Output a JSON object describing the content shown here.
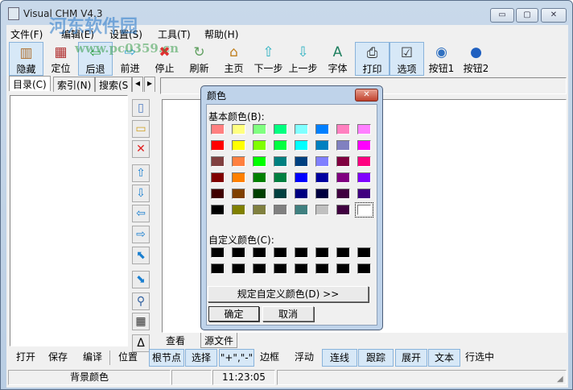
{
  "window": {
    "title": "Visual CHM V4.3",
    "minimize": "▭",
    "maximize": "▢",
    "close": "✕"
  },
  "watermark": {
    "name": "河东软件园",
    "url": "www.pc0359.cn"
  },
  "menu": [
    "文件(F)",
    "编辑(E)",
    "设置(S)",
    "工具(T)",
    "帮助(H)"
  ],
  "toolbar": [
    {
      "label": "隐藏",
      "icon": "hide-icon",
      "glyph": "▥",
      "active": true
    },
    {
      "label": "定位",
      "icon": "locate-icon",
      "glyph": "▦",
      "active": false
    },
    {
      "label": "后退",
      "icon": "back-arrow-icon",
      "glyph": "⇦",
      "active": true
    },
    {
      "label": "前进",
      "icon": "forward-arrow-icon",
      "glyph": "⇨",
      "active": false
    },
    {
      "label": "停止",
      "icon": "stop-icon",
      "glyph": "✖",
      "active": false
    },
    {
      "label": "刷新",
      "icon": "refresh-icon",
      "glyph": "↻",
      "active": false
    },
    {
      "label": "主页",
      "icon": "home-icon",
      "glyph": "⌂",
      "active": false
    },
    {
      "label": "下一步",
      "icon": "up-arrow-icon",
      "glyph": "⇧",
      "active": false
    },
    {
      "label": "上一步",
      "icon": "down-arrow-icon",
      "glyph": "⇩",
      "active": false
    },
    {
      "label": "字体",
      "icon": "font-icon",
      "glyph": "A",
      "active": false
    },
    {
      "label": "打印",
      "icon": "printer-icon",
      "glyph": "⎙",
      "active": true
    },
    {
      "label": "选项",
      "icon": "options-icon",
      "glyph": "☑",
      "active": true
    },
    {
      "label": "按钮1",
      "icon": "button1-icon",
      "glyph": "◉",
      "active": false
    },
    {
      "label": "按钮2",
      "icon": "button2-icon",
      "glyph": "●",
      "active": false
    }
  ],
  "left_tabs": [
    "目录(C)",
    "索引(N)",
    "搜索(S"
  ],
  "side_buttons": [
    {
      "icon": "new-file-icon",
      "glyph": "▯"
    },
    {
      "icon": "open-folder-icon",
      "glyph": "▭"
    },
    {
      "icon": "delete-icon",
      "glyph": "✕"
    },
    {
      "icon": "move-up-icon",
      "glyph": "⇧"
    },
    {
      "icon": "move-down-icon",
      "glyph": "⇩"
    },
    {
      "icon": "move-left-icon",
      "glyph": "⇦"
    },
    {
      "icon": "move-right-icon",
      "glyph": "⇨"
    },
    {
      "icon": "promote-icon",
      "glyph": "⬉"
    },
    {
      "icon": "demote-icon",
      "glyph": "⬊"
    },
    {
      "icon": "search-icon",
      "glyph": "⚲"
    },
    {
      "icon": "color-grid-icon",
      "glyph": "▦"
    },
    {
      "icon": "delta-icon",
      "glyph": "Δ"
    }
  ],
  "right_tabs": [
    "查看",
    "源文件"
  ],
  "bottom_toolbar": [
    {
      "label": "打开",
      "active": false
    },
    {
      "label": "保存",
      "active": false
    },
    {
      "label": "编译",
      "active": false
    },
    {
      "label": "位置",
      "active": false
    },
    {
      "label": "根节点",
      "active": true
    },
    {
      "label": "选择",
      "active": true
    },
    {
      "label": "\"+\",\"-\"",
      "active": true
    },
    {
      "label": "边框",
      "active": false
    },
    {
      "label": "浮动",
      "active": false
    },
    {
      "label": "连线",
      "active": true
    },
    {
      "label": "跟踪",
      "active": true
    },
    {
      "label": "展开",
      "active": true
    },
    {
      "label": "文本",
      "active": true
    },
    {
      "label": "行选中",
      "active": false
    }
  ],
  "status": [
    "背景颜色",
    "",
    "11:23:05",
    ""
  ],
  "dialog": {
    "title": "颜色",
    "basic_label": "基本颜色(B):",
    "custom_label": "自定义颜色(C):",
    "define_button": "规定自定义颜色(D) >>",
    "ok": "确定",
    "cancel": "取消",
    "basic_colors": [
      "#FF8080",
      "#FFFF80",
      "#80FF80",
      "#00FF80",
      "#80FFFF",
      "#0080FF",
      "#FF80C0",
      "#FF80FF",
      "#FF0000",
      "#FFFF00",
      "#80FF00",
      "#00FF40",
      "#00FFFF",
      "#0080C0",
      "#8080C0",
      "#FF00FF",
      "#804040",
      "#FF8040",
      "#00FF00",
      "#008080",
      "#004080",
      "#8080FF",
      "#800040",
      "#FF0080",
      "#800000",
      "#FF8000",
      "#008000",
      "#008040",
      "#0000FF",
      "#0000A0",
      "#800080",
      "#8000FF",
      "#400000",
      "#804000",
      "#004000",
      "#004040",
      "#000080",
      "#000040",
      "#400040",
      "#400080",
      "#000000",
      "#808000",
      "#808040",
      "#808080",
      "#408080",
      "#C0C0C0",
      "#400040",
      "#FFFFFF"
    ],
    "selected_index": 47,
    "custom_colors": [
      "#000000",
      "#000000",
      "#000000",
      "#000000",
      "#000000",
      "#000000",
      "#000000",
      "#000000",
      "#000000",
      "#000000",
      "#000000",
      "#000000",
      "#000000",
      "#000000",
      "#000000",
      "#000000"
    ]
  }
}
